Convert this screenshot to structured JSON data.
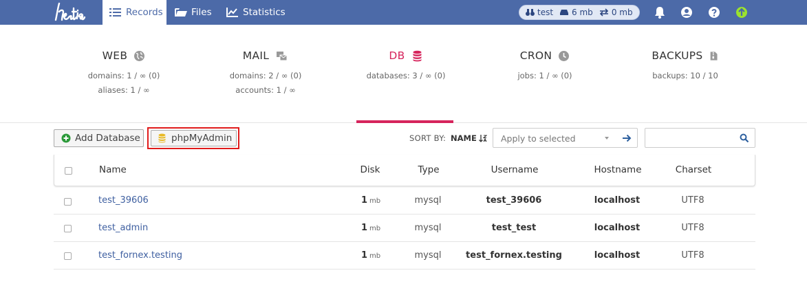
{
  "topbar": {
    "tabs": [
      {
        "label": "Records",
        "icon": "list-icon",
        "active": true
      },
      {
        "label": "Files",
        "icon": "folder-icon",
        "active": false
      },
      {
        "label": "Statistics",
        "icon": "chart-icon",
        "active": false
      }
    ],
    "usage": {
      "user": "test",
      "disk": "6 mb",
      "bandwidth": "0 mb"
    },
    "colors": {
      "bar": "#4c6aa8",
      "update": "#9be22d"
    }
  },
  "summary": [
    {
      "title": "WEB",
      "icon": "globe-icon",
      "line1": "domains: 1 / ∞ (0)",
      "line2": "aliases: 1 / ∞"
    },
    {
      "title": "MAIL",
      "icon": "mail-icon",
      "line1": "domains: 2 / ∞ (0)",
      "line2": "accounts: 1 / ∞"
    },
    {
      "title": "DB",
      "icon": "database-icon",
      "line1": "databases: 3 / ∞ (0)",
      "line2": "",
      "active": true
    },
    {
      "title": "CRON",
      "icon": "clock-icon",
      "line1": "jobs: 1 / ∞ (0)",
      "line2": ""
    },
    {
      "title": "BACKUPS",
      "icon": "file-archive-icon",
      "line1": "backups: 10 / 10",
      "line2": ""
    }
  ],
  "toolbar": {
    "add_label": "Add Database",
    "pma_label": "phpMyAdmin",
    "sort_label": "SORT BY:",
    "sort_value": "NAME",
    "apply_placeholder": "Apply to selected",
    "search_placeholder": ""
  },
  "table": {
    "headers": {
      "name": "Name",
      "disk": "Disk",
      "type": "Type",
      "username": "Username",
      "hostname": "Hostname",
      "charset": "Charset"
    },
    "rows": [
      {
        "name": "test_39606",
        "disk": "1",
        "unit": "mb",
        "type": "mysql",
        "username": "test_39606",
        "hostname": "localhost",
        "charset": "UTF8"
      },
      {
        "name": "test_admin",
        "disk": "1",
        "unit": "mb",
        "type": "mysql",
        "username": "test_test",
        "hostname": "localhost",
        "charset": "UTF8"
      },
      {
        "name": "test_fornex.testing",
        "disk": "1",
        "unit": "mb",
        "type": "mysql",
        "username": "test_fornex.testing",
        "hostname": "localhost",
        "charset": "UTF8"
      }
    ]
  }
}
